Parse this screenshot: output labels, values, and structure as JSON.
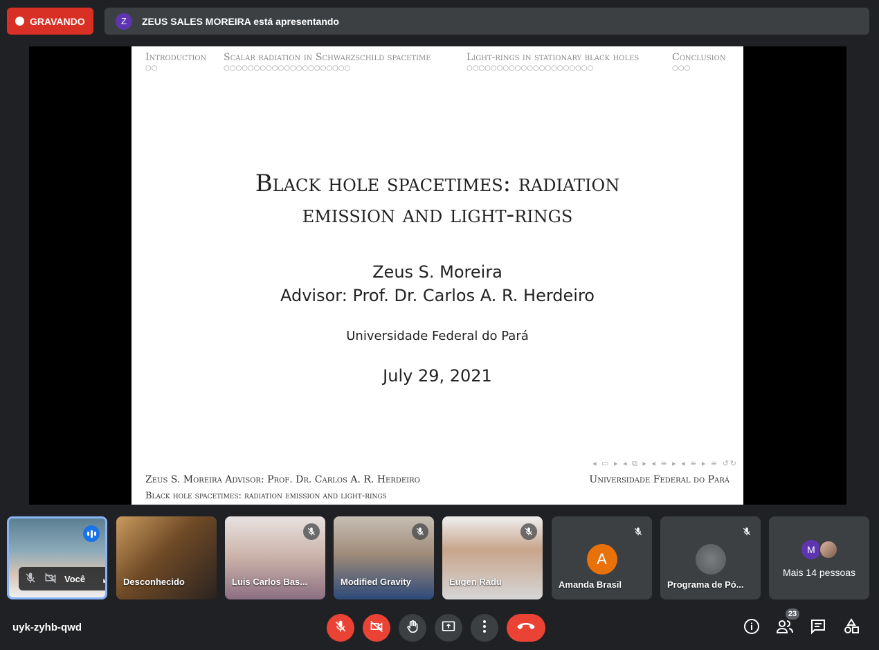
{
  "recording": {
    "label": "GRAVANDO"
  },
  "presenter": {
    "initial": "Z",
    "text": "ZEUS SALES MOREIRA está apresentando"
  },
  "slide": {
    "sections": [
      {
        "name": "Introduction",
        "dots": "○○"
      },
      {
        "name": "Scalar radiation in Schwarzschild spacetime",
        "dots": "○○○○○○○○○○○○○○○○○○○○○"
      },
      {
        "name": "Light-rings in stationary black holes",
        "dots": "○○○○○○○○○○○○○○○○○○○○○"
      },
      {
        "name": "Conclusion",
        "dots": "○○○"
      }
    ],
    "title_line1": "Black hole spacetimes: radiation",
    "title_line2": "emission and light-rings",
    "author": "Zeus S. Moreira",
    "advisor": "Advisor: Prof. Dr. Carlos A. R. Herdeiro",
    "university": "Universidade Federal do Pará",
    "date": "July 29, 2021",
    "footer_left_line1": "Zeus S. Moreira  Advisor: Prof. Dr. Carlos A. R. Herdeiro",
    "footer_left_line2": "Black hole spacetimes: radiation emission and light-rings",
    "footer_right": "Universidade Federal do Pará"
  },
  "participants": [
    {
      "name": "Você",
      "self": true
    },
    {
      "name": "Desconhecido"
    },
    {
      "name": "Luis Carlos Bas..."
    },
    {
      "name": "Modified Gravity"
    },
    {
      "name": "Eugen Radu"
    },
    {
      "name": "Amanda Brasil",
      "initial": "A"
    },
    {
      "name": "Programa de Pó..."
    },
    {
      "name": "Mais 14 pessoas",
      "initial": "M"
    }
  ],
  "meeting": {
    "code": "uyk-zyhb-qwd",
    "people_count": "23"
  },
  "colors": {
    "accent": "#8ab4f8",
    "danger": "#ea4335",
    "bg": "#202124",
    "tile": "#3c4043"
  }
}
